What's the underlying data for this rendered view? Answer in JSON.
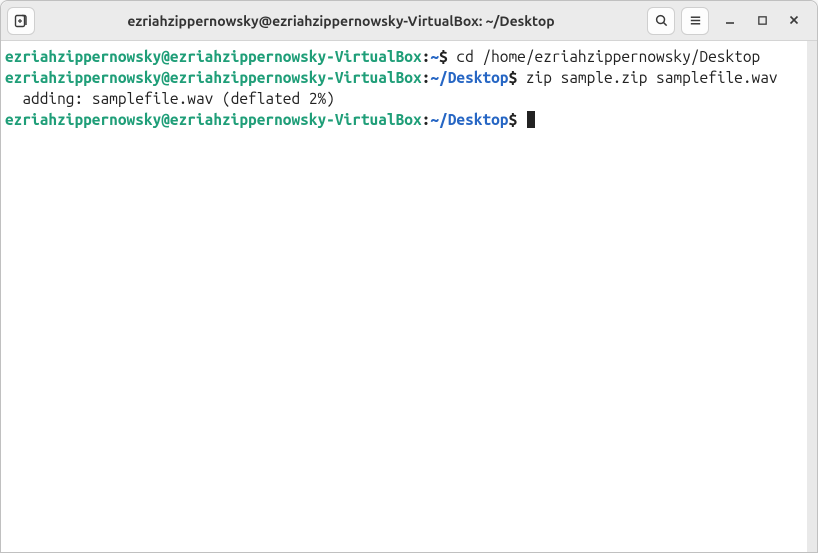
{
  "title": "ezriahzippernowsky@ezriahzippernowsky-VirtualBox: ~/Desktop",
  "prompts": {
    "userhost": "ezriahzippernowsky@ezriahzippernowsky-VirtualBox",
    "sep": ":",
    "home_tilde": "~",
    "path_desktop": "/Desktop",
    "dollar": "$"
  },
  "lines": {
    "cmd1": " cd /home/ezriahzippernowsky/Desktop",
    "cmd2": " zip sample.zip samplefile.wav",
    "zip_output": "  adding: samplefile.wav (deflated 2%)",
    "cmd3": " "
  },
  "icons": {
    "newtab": "new-tab-icon",
    "search": "search-icon",
    "menu": "hamburger-icon",
    "minimize": "minimize-icon",
    "maximize": "maximize-icon",
    "close": "close-icon"
  }
}
